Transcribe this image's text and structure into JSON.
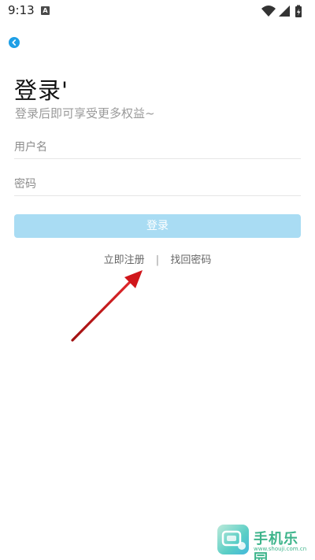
{
  "status_bar": {
    "time": "9:13",
    "notification_icon_letter": "A",
    "icons": [
      "wifi-icon",
      "signal-icon",
      "battery-charging-icon"
    ]
  },
  "header": {
    "back_icon": "chevron-left-icon"
  },
  "title": "登录'",
  "subtitle": "登录后即可享受更多权益~",
  "form": {
    "username_placeholder": "用户名",
    "password_placeholder": "密码",
    "login_label": "登录"
  },
  "links": {
    "register": "立即注册",
    "separator": "|",
    "recover_password": "找回密码"
  },
  "watermark": {
    "title": "手机乐园",
    "url": "www.shouji.com.cn"
  },
  "colors": {
    "accent": "#1e9fe6",
    "login_button_disabled": "#a9dcf3",
    "annotation_arrow": "#d0161b",
    "watermark": "#3db48b"
  }
}
